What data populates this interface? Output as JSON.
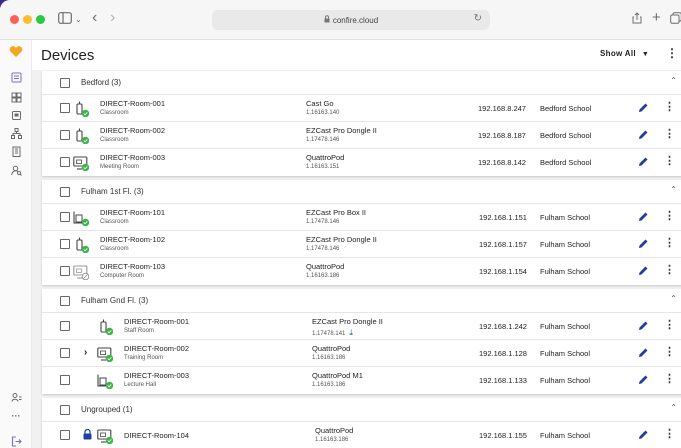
{
  "browser": {
    "url": "confire.cloud",
    "tab_icon": "sidebar-icon",
    "nav_back": "‹",
    "nav_forward": "›"
  },
  "header": {
    "title": "Devices",
    "show_all_label": "Show All"
  },
  "groups": [
    {
      "name": "Bedford (3)",
      "rows": [
        {
          "name": "DIRECT-Room-001",
          "room": "Classroom",
          "model": "Cast Go",
          "version": "1.16163.140",
          "ip": "192.168.8.247",
          "site": "Bedford School",
          "device": "dongle"
        },
        {
          "name": "DIRECT-Room-002",
          "room": "Classroom",
          "model": "EZCast Pro Dongle II",
          "version": "1.17478.146",
          "ip": "192.168.8.187",
          "site": "Bedford School",
          "device": "dongle"
        },
        {
          "name": "DIRECT-Room-003",
          "room": "Meeting Room",
          "model": "QuattroPod",
          "version": "1.16163.151",
          "ip": "192.168.8.142",
          "site": "Bedford School",
          "device": "monitor"
        }
      ]
    },
    {
      "name": "Fulham 1st Fl. (3)",
      "rows": [
        {
          "name": "DIRECT-Room-101",
          "room": "Classroom",
          "model": "EZCast Pro Box II",
          "version": "1.17478.146",
          "ip": "192.168.1.151",
          "site": "Fulham School",
          "device": "box"
        },
        {
          "name": "DIRECT-Room-102",
          "room": "Classroom",
          "model": "EZCast Pro Dongle II",
          "version": "1.17478.146",
          "ip": "192.168.1.157",
          "site": "Fulham School",
          "device": "dongle"
        },
        {
          "name": "DIRECT-Room-103",
          "room": "Computer Room",
          "model": "QuattroPod",
          "version": "1.16163.186",
          "ip": "192.168.1.154",
          "site": "Fulham School",
          "device": "monitor-gray"
        }
      ]
    },
    {
      "name": "Fulham Gnd Fl. (3)",
      "rows": [
        {
          "name": "DIRECT-Room-001",
          "room": "Staff Room",
          "model": "EZCast Pro Dongle II",
          "version": "1.17478.141",
          "ip": "192.168.1.242",
          "site": "Fulham School",
          "device": "dongle",
          "download": true
        },
        {
          "name": "DIRECT-Room-002",
          "room": "Training Room",
          "model": "QuattroPod",
          "version": "1.16163.186",
          "ip": "192.168.1.128",
          "site": "Fulham School",
          "device": "monitor",
          "expander": "›"
        },
        {
          "name": "DIRECT-Room-003",
          "room": "Lecture Hall",
          "model": "QuattroPod M1",
          "version": "1.16163.186",
          "ip": "192.168.1.133",
          "site": "Fulham School",
          "device": "box"
        }
      ]
    },
    {
      "name": "Ungrouped (1)",
      "rows": [
        {
          "name": "DIRECT-Room-104",
          "room": "",
          "model": "QuattroPod",
          "version": "1.16163.186",
          "ip": "192.168.1.155",
          "site": "Fulham School",
          "device": "monitor",
          "locked": true
        }
      ]
    }
  ],
  "colors": {
    "accent": "#1f3fa0",
    "online": "#3bb54a",
    "brand": "#f5a623"
  }
}
